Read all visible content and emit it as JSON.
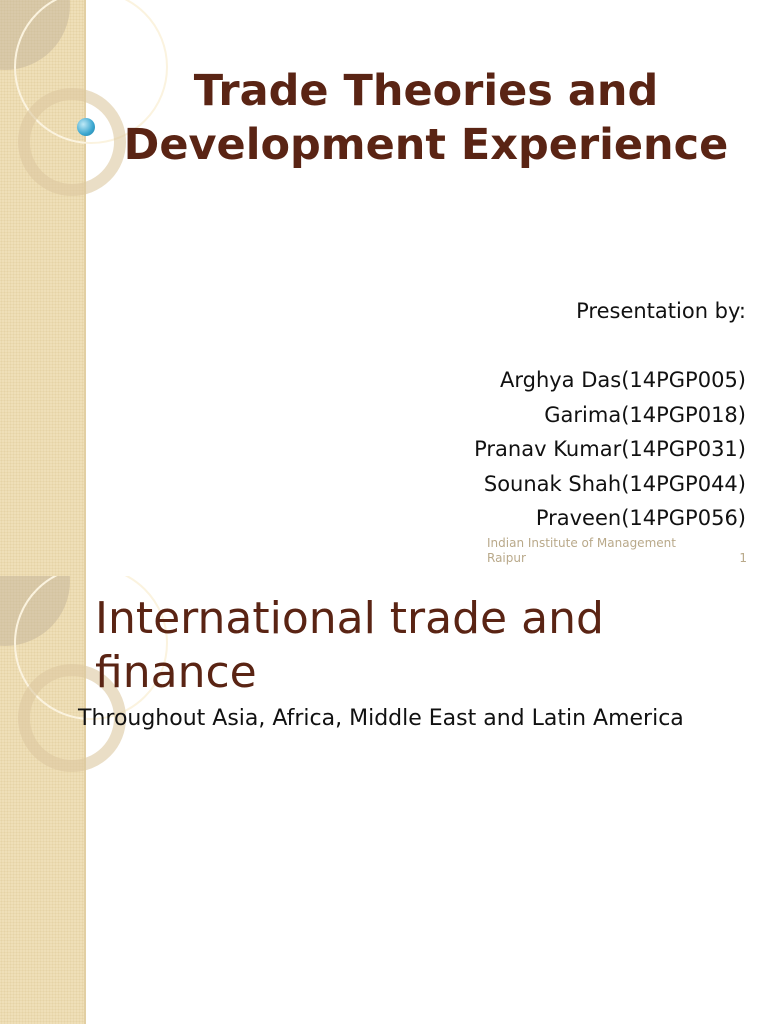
{
  "slide1": {
    "title_line1": "Trade Theories and",
    "title_line2": "Development Experience",
    "presentation_by": "Presentation by:",
    "presenters": [
      "Arghya Das(14PGP005)",
      "Garima(14PGP018)",
      "Pranav Kumar(14PGP031)",
      "Sounak Shah(14PGP044)",
      "Praveen(14PGP056)"
    ],
    "footer_line1": "Indian Institute of Management",
    "footer_line2": "Raipur",
    "slide_number": "1"
  },
  "slide2": {
    "title_line1": "International trade and",
    "title_line2": "finance",
    "subtitle": "Throughout Asia, Africa, Middle East and Latin America"
  },
  "colors": {
    "title": "#5a2414",
    "sidebar": "#efdfb8",
    "footer": "#b9a98a"
  }
}
